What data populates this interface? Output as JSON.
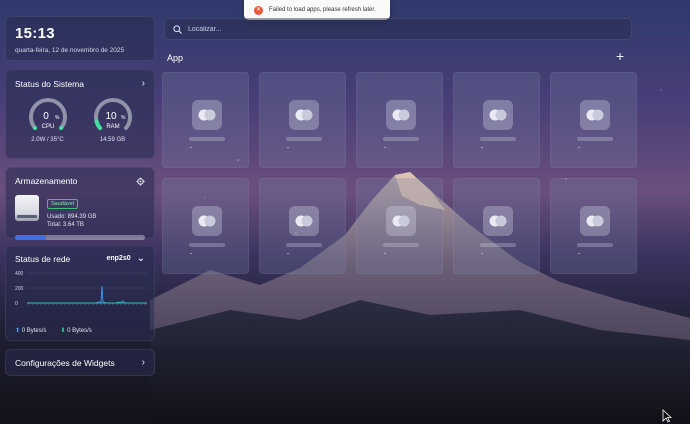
{
  "notification": {
    "message": "Failed to load apps, please refresh later."
  },
  "clock": {
    "time": "15:13",
    "date": "quarta-feira, 12 de novembro de 2025"
  },
  "system_status": {
    "title": "Status do Sistema",
    "cpu": {
      "value": "0",
      "unit": "%",
      "label": "CPU",
      "detail": "2.0W / 35°C",
      "fraction": 0.0,
      "color": "#3fe0a0"
    },
    "ram": {
      "value": "10",
      "unit": "%",
      "label": "RAM",
      "detail": "14.59 GB",
      "fraction": 0.1,
      "color": "#3fe0a0"
    }
  },
  "storage": {
    "title": "Armazenamento",
    "health": "Saudável",
    "used": "Usado: 894.39 GB",
    "total": "Total: 3.64 TB",
    "used_fraction": 0.24,
    "bar_color": "#3f6fe0"
  },
  "network": {
    "title": "Status de rede",
    "interface": "enp2s0",
    "y_ticks": [
      "400",
      "200",
      "0"
    ],
    "upload": "0 Bytes/s",
    "download": "0 Bytes/s"
  },
  "widgets": {
    "title": "Configurações de Widgets"
  },
  "search": {
    "placeholder": "Localizar..."
  },
  "apps": {
    "title": "App",
    "tile_count": 10
  }
}
